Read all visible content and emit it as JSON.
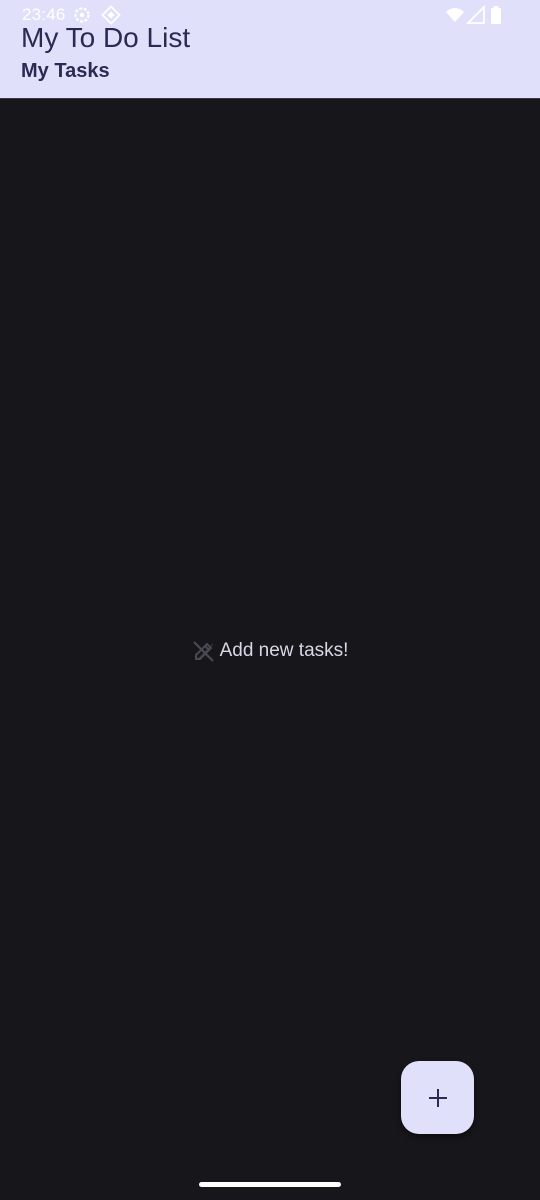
{
  "status_bar": {
    "time": "23:46",
    "icons": [
      "settings-icon",
      "location-icon",
      "wifi-icon",
      "signal-icon",
      "battery-icon"
    ]
  },
  "app_bar": {
    "title": "My To Do List",
    "subtitle": "My Tasks"
  },
  "empty_state": {
    "icon": "edit-off-icon",
    "text": "Add new tasks!"
  },
  "fab": {
    "icon": "plus-icon"
  },
  "colors": {
    "background": "#17161b",
    "app_bar": "#e1e0fb",
    "title_text": "#2b2a52",
    "empty_text": "#d9d7e5",
    "fab": "#e1e0fb"
  }
}
